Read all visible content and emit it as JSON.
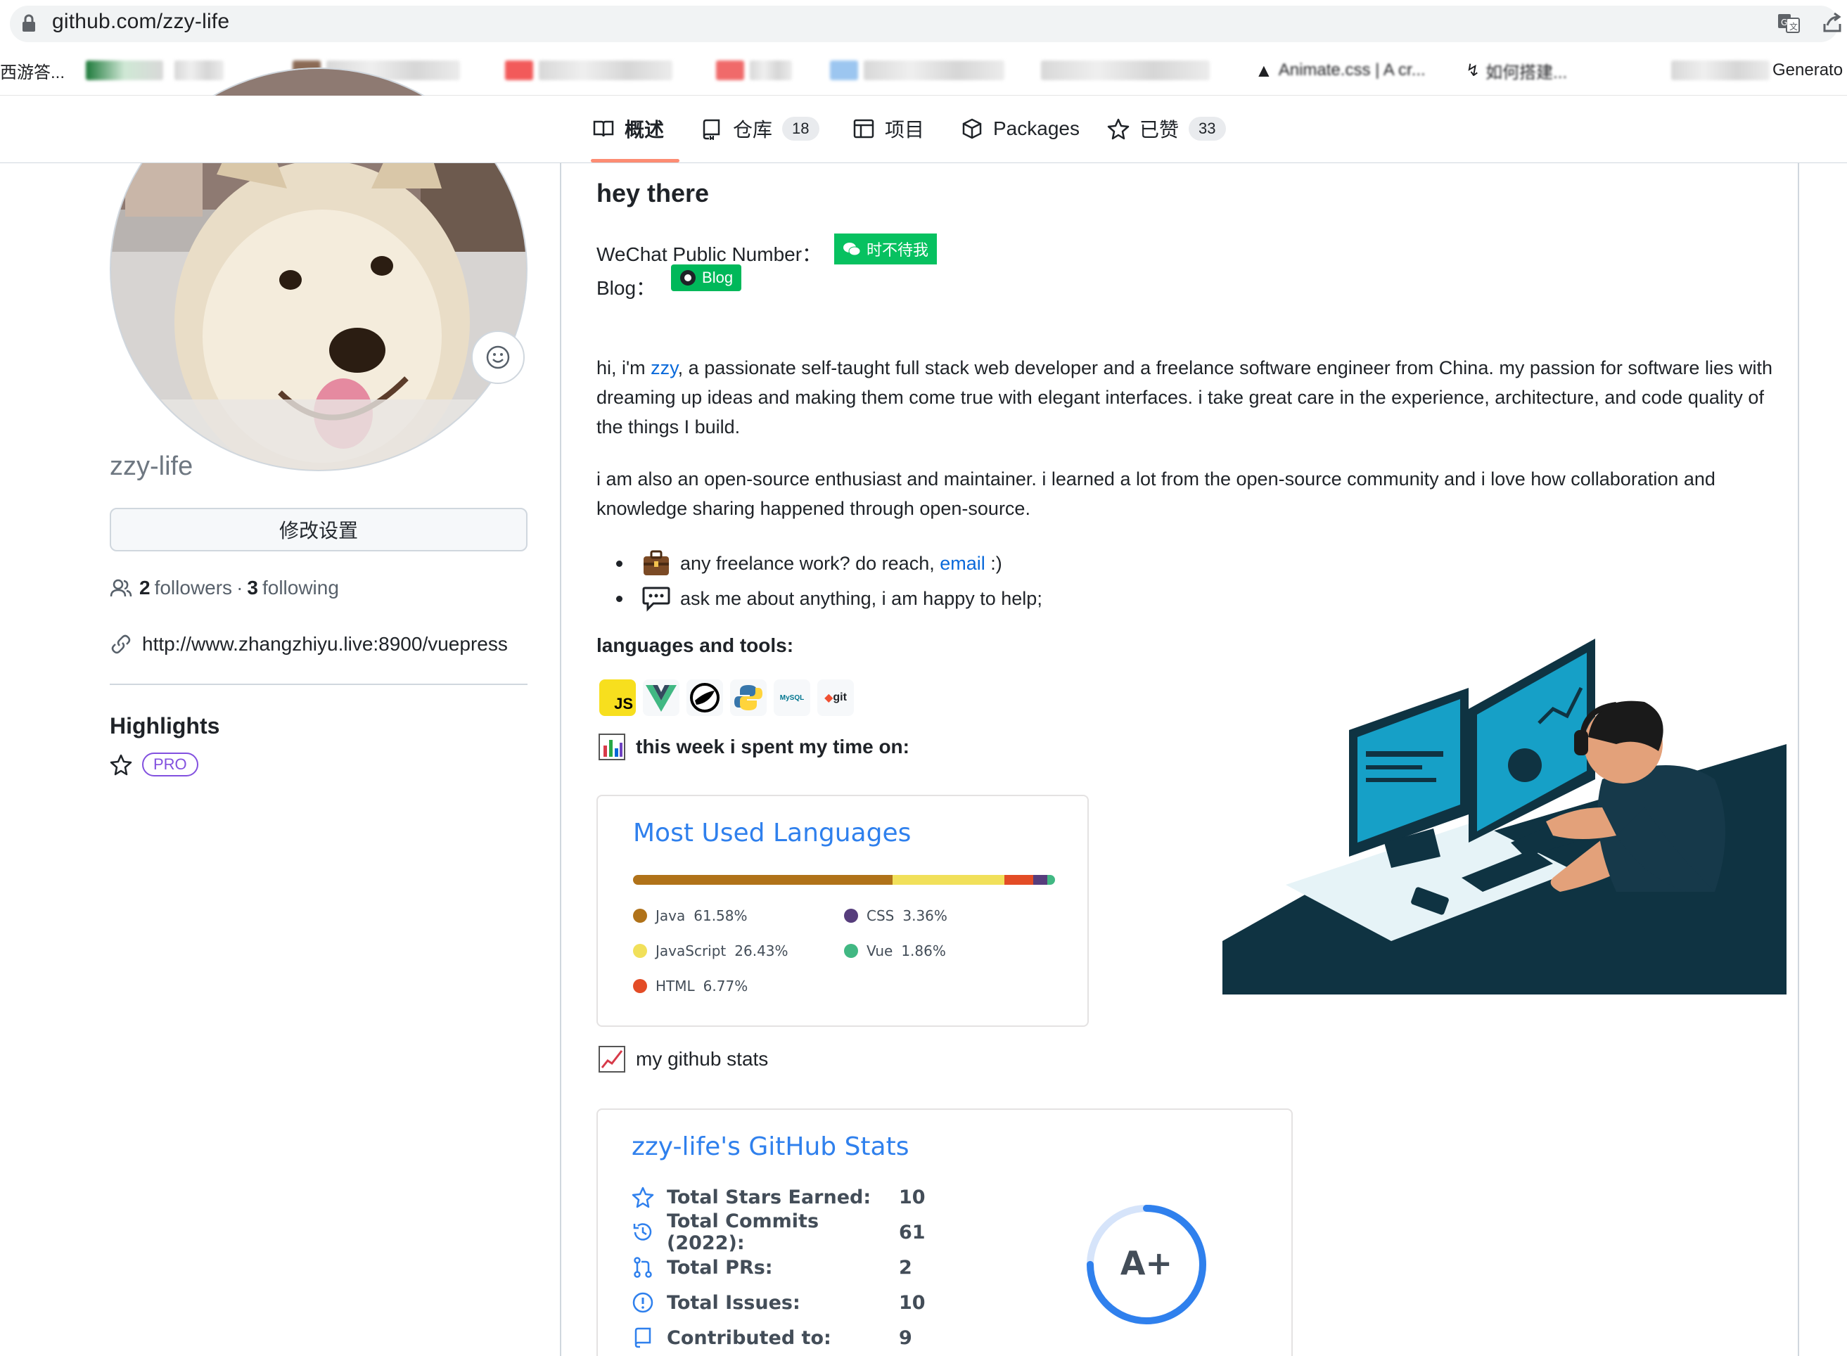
{
  "browser": {
    "url": "github.com/zzy-life",
    "bookmarks": [
      "西游答...",
      "Animate.css | A cr...",
      "如何搭建...",
      "Generato"
    ]
  },
  "nav": {
    "tabs": [
      {
        "label": "概述",
        "active": true
      },
      {
        "label": "仓库",
        "count": "18"
      },
      {
        "label": "项目"
      },
      {
        "label": "Packages"
      },
      {
        "label": "已赞",
        "count": "33"
      }
    ]
  },
  "profile": {
    "username": "zzy-life",
    "edit_button": "修改设置",
    "followers_count": "2",
    "followers_label": "followers",
    "separator": "·",
    "following_count": "3",
    "following_label": "following",
    "website": "http://www.zhangzhiyu.live:8900/vuepress",
    "highlights_title": "Highlights",
    "pro_badge": "PRO"
  },
  "readme": {
    "heading": "hey there",
    "wechat_label": "WeChat Public Number：",
    "wechat_badge": "时不待我",
    "blog_label": "Blog：",
    "blog_badge": "Blog",
    "intro_pre": "hi, i'm ",
    "intro_link": "zzy",
    "intro_post": ", a passionate self-taught full stack web developer and a freelance software engineer from China. my passion for software lies with dreaming up ideas and making them come true with elegant interfaces. i take great care in the experience, architecture, and code quality of the things I build.",
    "para2": "i am also an open-source enthusiast and maintainer. i learned a lot from the open-source community and i love how collaboration and knowledge sharing happened through open-source.",
    "bullet1_pre": "any freelance work? do reach, ",
    "bullet1_link": "email",
    "bullet1_post": " :)",
    "bullet2": "ask me about anything, i am happy to help;",
    "tools_title": "languages and tools:",
    "tools": [
      "JS",
      "Vue",
      "Spring",
      "Python",
      "MySQL",
      "git"
    ],
    "week_pre": "this week i spent my time on:",
    "stats_heading": "my github stats"
  },
  "languages_card": {
    "title": "Most Used Languages",
    "items": [
      {
        "name": "Java",
        "percent": "61.58%",
        "value": 61.58,
        "color": "#b07219"
      },
      {
        "name": "JavaScript",
        "percent": "26.43%",
        "value": 26.43,
        "color": "#f1e05a"
      },
      {
        "name": "HTML",
        "percent": "6.77%",
        "value": 6.77,
        "color": "#e34c26"
      },
      {
        "name": "CSS",
        "percent": "3.36%",
        "value": 3.36,
        "color": "#563d7c"
      },
      {
        "name": "Vue",
        "percent": "1.86%",
        "value": 1.86,
        "color": "#41b883"
      }
    ]
  },
  "stats_card": {
    "title": "zzy-life's GitHub Stats",
    "rows": [
      {
        "icon": "star-icon",
        "label": "Total Stars Earned:",
        "value": "10"
      },
      {
        "icon": "history-icon",
        "label": "Total Commits (2022):",
        "value": "61"
      },
      {
        "icon": "pull-request-icon",
        "label": "Total PRs:",
        "value": "2"
      },
      {
        "icon": "issue-icon",
        "label": "Total Issues:",
        "value": "10"
      },
      {
        "icon": "repo-icon",
        "label": "Contributed to:",
        "value": "9"
      }
    ],
    "rank": "A+",
    "rank_fraction": 0.75,
    "accent": "#2f80ed"
  }
}
